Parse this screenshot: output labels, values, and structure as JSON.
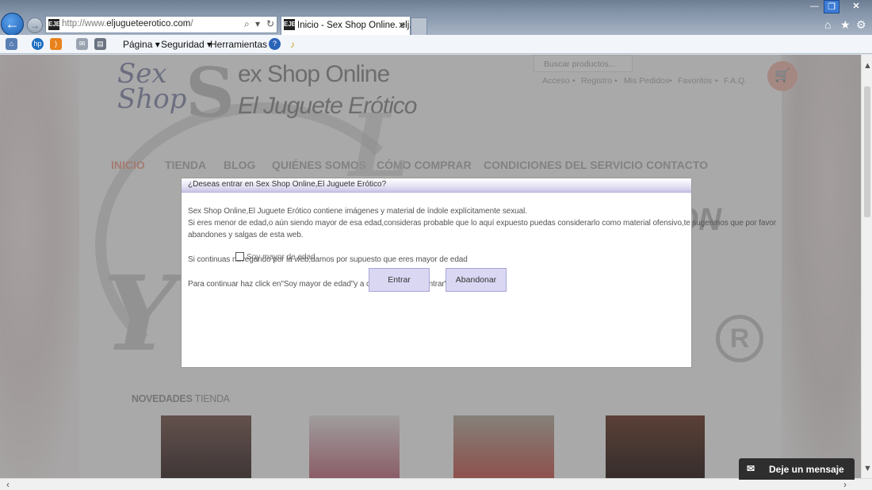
{
  "browser": {
    "back_icon": "←",
    "forward_icon": "→",
    "favicon_text": "EJE",
    "url_prefix": "http://www.",
    "url_domain": "eljugueteerotico.com",
    "url_suffix": "/",
    "tab_title": "Inicio - Sex Shop Online. elj...",
    "tab_close": "✕",
    "window_buttons": {
      "minimize": "—",
      "maximize": "❐",
      "close": "✕"
    }
  },
  "command_bar": {
    "pagina": "Página ▾",
    "seguridad": "Seguridad ▾",
    "herramientas": "Herramientas ▾",
    "help": "?"
  },
  "site": {
    "logo_script": "Sex Shop",
    "logo_line1": "ex Shop Online",
    "logo_line2": "El Juguete Erótico",
    "search_placeholder": "Buscar productos...",
    "toplinks": [
      "Acceso",
      "Registro",
      "Mis Pedidos",
      "Favoritos",
      "F.A.Q."
    ],
    "separator": "•",
    "nav": [
      "INICIO",
      "TIENDA",
      "BLOG",
      "QUIÉNES SOMOS",
      "CÓMO COMPRAR",
      "CONDICIONES DEL SERVICIO",
      "CONTACTO"
    ],
    "novedades_bold": "NOVEDADES",
    "novedades_rest": "TIENDA"
  },
  "modal": {
    "title": "¿Deseas entrar en Sex Shop Online,El Juguete Erótico?",
    "line1": "Sex Shop Online,El Juguete Erótico contiene imágenes y material de índole explícitamente sexual.",
    "line2": "Si eres menor de edad,o aún siendo mayor de esa edad,consideras probable que lo aquí expuesto puedas considerarlo como material ofensivo,te sugerimos que por favor",
    "line3": "abandones y salgas de esta web.",
    "line4": "Si continuas navegando por la web,damos por supuesto que eres mayor de edad",
    "checkbox_label": "Soy mayor de edad",
    "line5": "Para continuar haz click en\"Soy mayor de edad\"y a continuación en\"Entrar\"",
    "enter_button": "Entrar",
    "leave_button": "Abandonar"
  },
  "chat": {
    "label": "Deje un mensaje"
  },
  "colors": {
    "nav_active": "#f0a796",
    "modal_button": "#d9d7f2",
    "chat_bg": "#2e2e2e"
  }
}
